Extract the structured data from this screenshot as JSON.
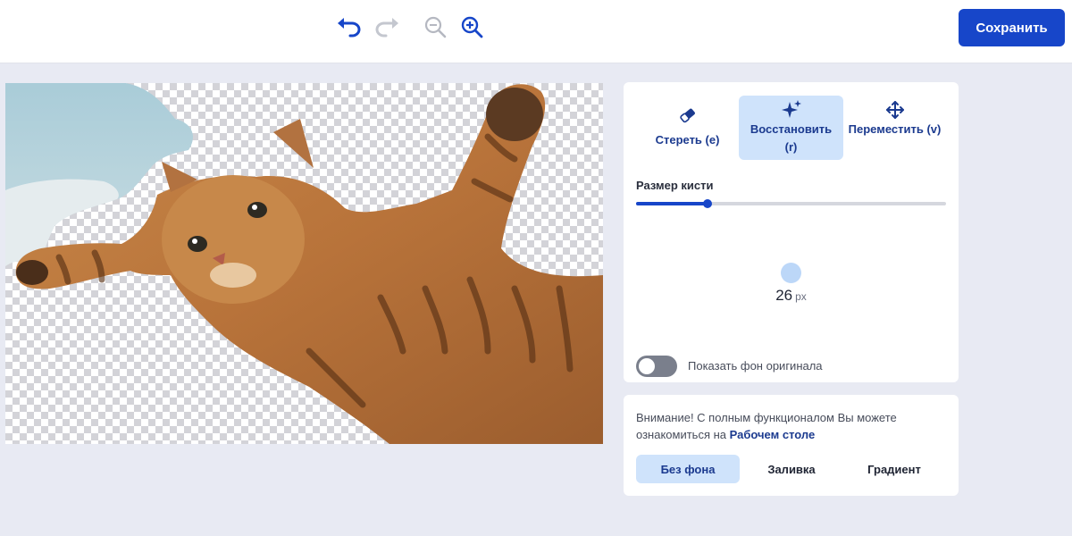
{
  "toolbar": {
    "undo_icon": "undo-arrow-icon",
    "redo_icon": "redo-arrow-icon",
    "zoom_out_icon": "zoom-out-icon",
    "zoom_in_icon": "zoom-in-icon",
    "save_label": "Сохранить"
  },
  "tools": [
    {
      "icon": "eraser-icon",
      "label": "Стереть (e)",
      "active": false
    },
    {
      "icon": "sparkles-icon",
      "label": "Восстановить (r)",
      "active": true
    },
    {
      "icon": "move-arrows-icon",
      "label": "Переместить (v)",
      "active": false
    }
  ],
  "brush": {
    "title": "Размер кисти",
    "value": "26",
    "unit": "px",
    "slider_fraction": 0.23
  },
  "toggle": {
    "label": "Показать фон оригинала",
    "on": false
  },
  "notice": {
    "text": "Внимание! С полным функционалом Вы можете ознакомиться на ",
    "link": "Рабочем столе"
  },
  "background_tabs": [
    {
      "label": "Без фона",
      "active": true
    },
    {
      "label": "Заливка",
      "active": false
    },
    {
      "label": "Градиент",
      "active": false
    }
  ],
  "colors": {
    "accent": "#1746c9",
    "active_bg": "#cfe3fb",
    "page_bg": "#e8eaf3"
  }
}
